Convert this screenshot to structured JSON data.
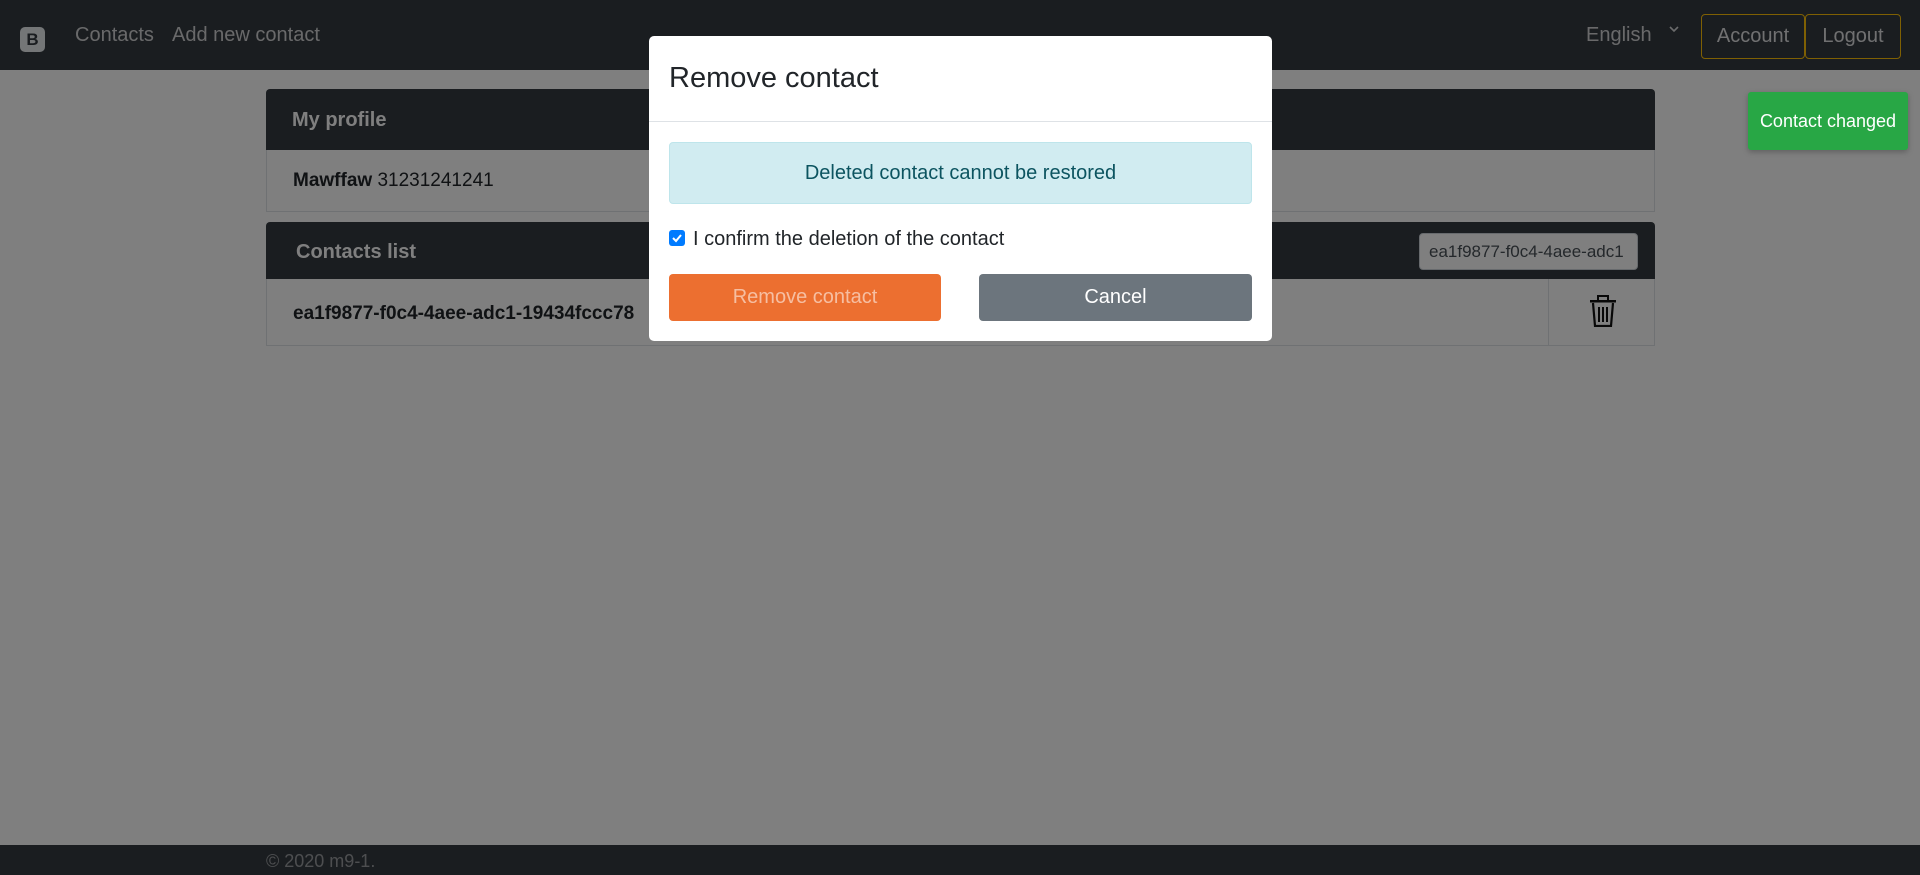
{
  "navbar": {
    "brand": "B",
    "links": [
      "Contacts",
      "Add new contact"
    ],
    "language": "English",
    "account_label": "Account",
    "logout_label": "Logout"
  },
  "profile": {
    "header": "My profile",
    "name": "Mawffaw",
    "phone": "31231241241"
  },
  "contacts": {
    "header": "Contacts list",
    "search_value": "ea1f9877-f0c4-4aee-adc1",
    "rows": [
      {
        "id": "ea1f9877-f0c4-4aee-adc1-19434fccc78"
      }
    ]
  },
  "toast": {
    "text": "Contact changed",
    "color": "#28a745"
  },
  "modal": {
    "title": "Remove contact",
    "alert": "Deleted contact cannot be restored",
    "confirm_label": "I confirm the deletion of the contact",
    "confirm_checked": true,
    "remove_label": "Remove contact",
    "cancel_label": "Cancel",
    "colors": {
      "remove": "#ec6f30",
      "cancel": "#6c757d",
      "alert_bg": "#d1ecf1"
    }
  },
  "footer": {
    "text": "© 2020 m9-1."
  }
}
